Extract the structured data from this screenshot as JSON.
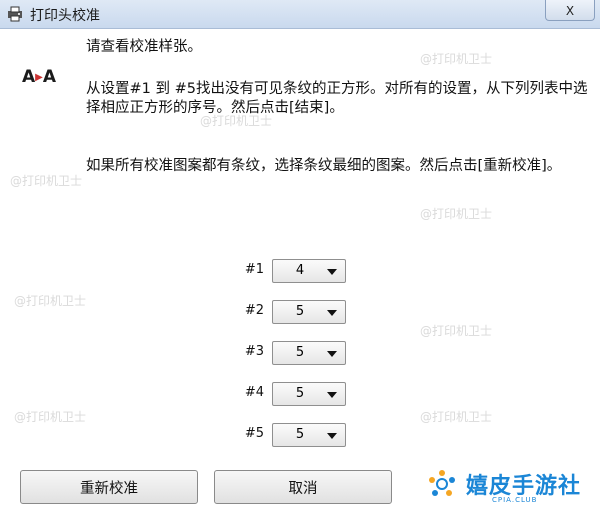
{
  "window": {
    "title": "打印头校准",
    "close_label": "X"
  },
  "logo_icon": {
    "text_left": "A",
    "text_right": "A"
  },
  "instructions": {
    "p1": "请查看校准样张。",
    "p2": "从设置#1 到 #5找出没有可见条纹的正方形。对所有的设置，从下列列表中选择相应正方形的序号。然后点击[结束]。",
    "p3": "如果所有校准图案都有条纹，选择条纹最细的图案。然后点击[重新校准]。"
  },
  "settings": [
    {
      "label": "#1",
      "value": "4"
    },
    {
      "label": "#2",
      "value": "5"
    },
    {
      "label": "#3",
      "value": "5"
    },
    {
      "label": "#4",
      "value": "5"
    },
    {
      "label": "#5",
      "value": "5"
    }
  ],
  "buttons": {
    "recalibrate": "重新校准",
    "cancel": "取消"
  },
  "watermark": "@打印机卫士",
  "brand": {
    "name": "嬉皮手游社",
    "url": "CPIA.CLUB",
    "color": "#1b86d6"
  }
}
